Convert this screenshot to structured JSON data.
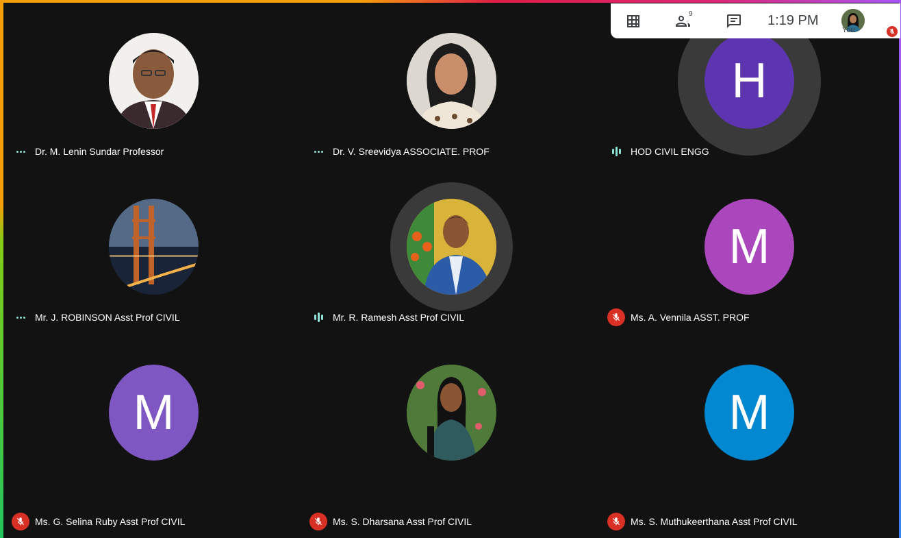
{
  "toolbar": {
    "clock": "1:19 PM",
    "self_label": "You",
    "participant_count_badge": "9"
  },
  "participants": [
    {
      "name": "Dr. M. Lenin Sundar Professor",
      "status": "idle",
      "avatar": "photo"
    },
    {
      "name": "Dr. V. Sreevidya ASSOCIATE. PROF",
      "status": "idle",
      "avatar": "photo"
    },
    {
      "name": "HOD CIVIL ENGG",
      "status": "speaking",
      "avatar": "initial",
      "initial": "H",
      "color": "#5e35b1"
    },
    {
      "name": "Mr. J. ROBINSON Asst Prof CIVIL",
      "status": "idle",
      "avatar": "photo"
    },
    {
      "name": "Mr. R. Ramesh Asst Prof CIVIL",
      "status": "speaking",
      "avatar": "photo"
    },
    {
      "name": "Ms. A. Vennila ASST. PROF",
      "status": "muted",
      "avatar": "initial",
      "initial": "M",
      "color": "#ab47bc"
    },
    {
      "name": "Ms. G. Selina Ruby Asst Prof CIVIL",
      "status": "muted",
      "avatar": "initial",
      "initial": "M",
      "color": "#7e57c2"
    },
    {
      "name": "Ms. S. Dharsana Asst Prof CIVIL",
      "status": "muted",
      "avatar": "photo"
    },
    {
      "name": "Ms. S. Muthukeerthana Asst Prof CIVIL",
      "status": "muted",
      "avatar": "initial",
      "initial": "M",
      "color": "#0288d1"
    }
  ],
  "colors": {
    "background": "#121212",
    "muted_red": "#d93025",
    "activity_teal": "#8ee3d5"
  }
}
